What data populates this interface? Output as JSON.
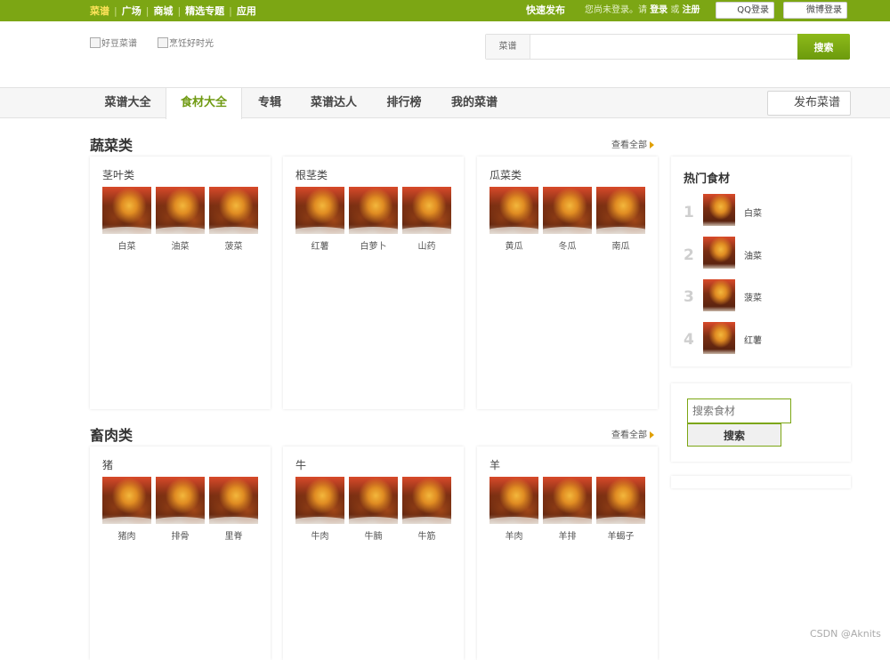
{
  "topbar": {
    "nav": [
      {
        "label": "菜谱",
        "active": true
      },
      {
        "label": "广场",
        "active": false
      },
      {
        "label": "商城",
        "active": false
      },
      {
        "label": "精选专题",
        "active": false
      },
      {
        "label": "应用",
        "active": false
      }
    ],
    "quick_publish": "快速发布",
    "login_prefix": "您尚未登录。请",
    "login_link": "登录",
    "or_text": "或",
    "register_link": "注册",
    "qq_login": "QQ登录",
    "weibo_login": "微博登录"
  },
  "header": {
    "logo1_alt": "好豆菜谱",
    "logo2_alt": "烹饪好时光",
    "search_category": "菜谱",
    "search_value": "",
    "search_button": "搜索"
  },
  "mainnav": {
    "items": [
      {
        "label": "菜谱大全",
        "active": false
      },
      {
        "label": "食材大全",
        "active": true
      },
      {
        "label": "专辑",
        "active": false
      },
      {
        "label": "菜谱达人",
        "active": false
      },
      {
        "label": "排行榜",
        "active": false
      },
      {
        "label": "我的菜谱",
        "active": false
      }
    ],
    "publish_button": "发布菜谱"
  },
  "sections": [
    {
      "title": "蔬菜类",
      "view_all": "查看全部",
      "cards": [
        {
          "title": "茎叶类",
          "items": [
            "白菜",
            "油菜",
            "菠菜"
          ]
        },
        {
          "title": "根茎类",
          "items": [
            "红薯",
            "白萝卜",
            "山药"
          ]
        },
        {
          "title": "瓜菜类",
          "items": [
            "黄瓜",
            "冬瓜",
            "南瓜"
          ]
        }
      ]
    },
    {
      "title": "畜肉类",
      "view_all": "查看全部",
      "cards": [
        {
          "title": "猪",
          "items": [
            "猪肉",
            "排骨",
            "里脊"
          ]
        },
        {
          "title": "牛",
          "items": [
            "牛肉",
            "牛腩",
            "牛筋"
          ]
        },
        {
          "title": "羊",
          "items": [
            "羊肉",
            "羊排",
            "羊蝎子"
          ]
        }
      ]
    }
  ],
  "sidebar": {
    "hot_title": "热门食材",
    "hot_items": [
      {
        "rank": "1",
        "label": "白菜"
      },
      {
        "rank": "2",
        "label": "油菜"
      },
      {
        "rank": "3",
        "label": "菠菜"
      },
      {
        "rank": "4",
        "label": "红薯"
      }
    ],
    "ingredient_search_placeholder": "搜索食材",
    "ingredient_search_value": "",
    "ingredient_search_button": "搜索"
  },
  "watermark": "CSDN @Aknits",
  "colors": {
    "brand_green": "#7ca614",
    "active_nav": "#6f9a12",
    "active_top": "#ffe35a"
  }
}
